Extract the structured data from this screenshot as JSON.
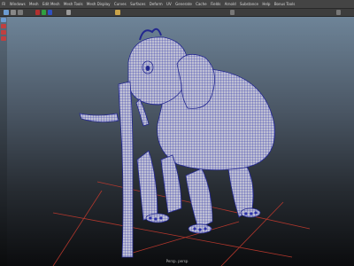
{
  "menus": [
    "Fil",
    "Windows",
    "Mesh",
    "Edit Mesh",
    "Mesh Tools",
    "Mesh Display",
    "Curves",
    "Surfaces",
    "Deform",
    "UV",
    "Generate",
    "Cache",
    "Fields",
    "Arnold",
    "Substance",
    "Help",
    "Bonus Tools"
  ],
  "viewport": {
    "panel_label": "polySurface1 (the elephant)",
    "camera_label": "Persp. persp"
  },
  "colors": {
    "mesh_fill": "#bfc0d4",
    "wire": "#2a2fa8",
    "grid": "#c23a2e",
    "menubar": "#444444"
  },
  "icons": [
    "select-tool-icon",
    "move-tool-icon",
    "rotate-tool-icon",
    "scale-tool-icon"
  ]
}
